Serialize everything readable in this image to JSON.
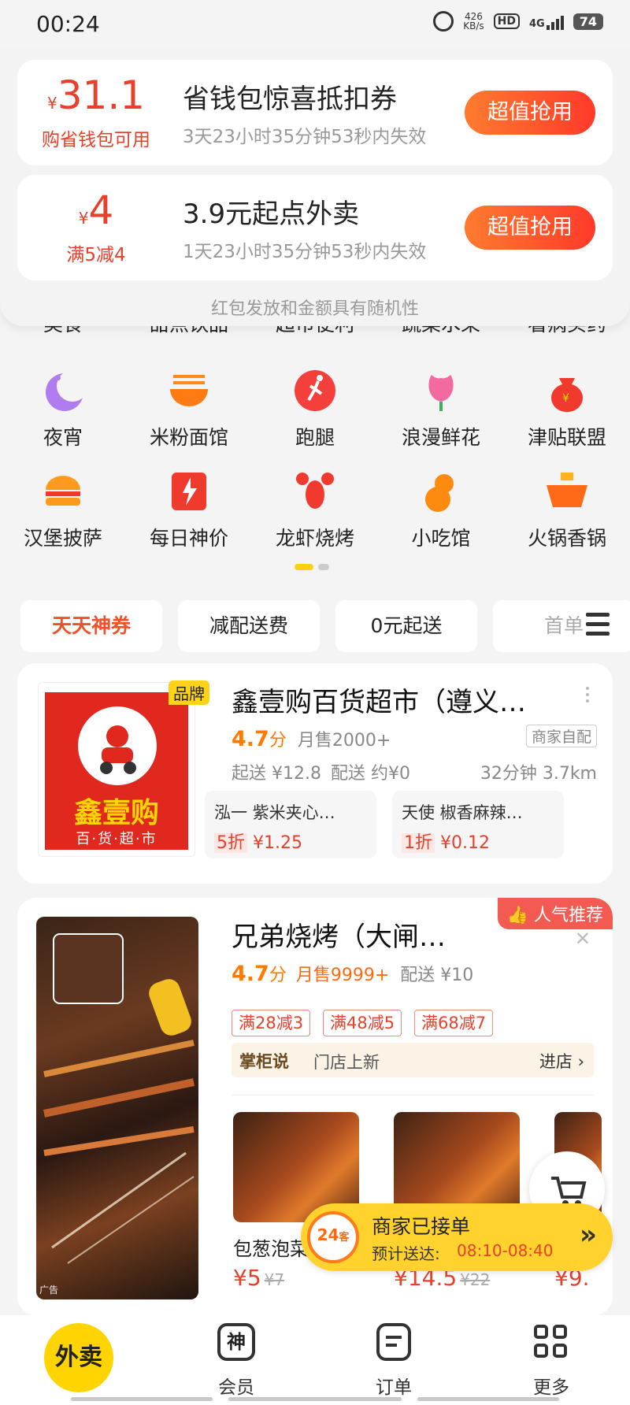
{
  "status_bar": {
    "time": "00:24",
    "speed_value": "426",
    "speed_unit": "KB/s",
    "hd": "HD",
    "network": "4G",
    "battery": "74"
  },
  "coupons": [
    {
      "symbol": "¥",
      "amount": "31.1",
      "condition": "购省钱包可用",
      "title": "省钱包惊喜抵扣券",
      "subtitle": "3天23小时35分钟53秒内失效",
      "button": "超值抢用"
    },
    {
      "symbol": "¥",
      "amount": "4",
      "condition": "满5减4",
      "title": "3.9元起点外卖",
      "subtitle": "1天23小时35分钟53秒内失效",
      "button": "超值抢用"
    }
  ],
  "disclaimer": "红包发放和金额具有随机性",
  "categories": {
    "row0": [
      "美食",
      "甜点饮品",
      "超市便利",
      "蔬菜水果",
      "看病买药"
    ],
    "row1": [
      {
        "label": "夜宵",
        "icon": "moon-icon"
      },
      {
        "label": "米粉面馆",
        "icon": "noodle-bowl-icon"
      },
      {
        "label": "跑腿",
        "icon": "runner-icon"
      },
      {
        "label": "浪漫鲜花",
        "icon": "flower-icon"
      },
      {
        "label": "津贴联盟",
        "icon": "money-bag-icon"
      }
    ],
    "row2": [
      {
        "label": "汉堡披萨",
        "icon": "burger-icon"
      },
      {
        "label": "每日神价",
        "icon": "lightning-icon"
      },
      {
        "label": "龙虾烧烤",
        "icon": "lobster-icon"
      },
      {
        "label": "小吃馆",
        "icon": "gourd-icon"
      },
      {
        "label": "火锅香锅",
        "icon": "hotpot-icon"
      }
    ]
  },
  "filters": [
    "天天神券",
    "减配送费",
    "0元起送",
    "首单"
  ],
  "store1": {
    "brand_tag": "品牌",
    "logo_text": "鑫壹购",
    "logo_sub": "百·货·超·市",
    "name": "鑫壹购百货超市（遵义…",
    "rating": "4.7",
    "rating_unit": "分",
    "monthly": "月售2000+",
    "delivery_tag": "商家自配",
    "min_order": "起送 ¥12.8",
    "delivery_fee": "配送 约¥0",
    "time_dist": "32分钟 3.7km",
    "deals": [
      {
        "name": "泓一 紫米夹心…",
        "discount": "5折",
        "price": "¥1.25"
      },
      {
        "name": "天使 椒香麻辣…",
        "discount": "1折",
        "price": "¥0.12"
      }
    ]
  },
  "store2": {
    "pop_tag": "人气推荐",
    "name": "兄弟烧烤（大闸…",
    "rating": "4.7",
    "rating_unit": "分",
    "monthly": "月售9999+",
    "delivery_fee": "配送 ¥10",
    "promos": [
      "满28减3",
      "满48减5",
      "满68减7"
    ],
    "say_label": "掌柜说",
    "say_text": "门店上新",
    "enter": "进店 ›",
    "ad_tag": "广告",
    "dishes": [
      {
        "name": "包葱泡菜",
        "price": "¥5",
        "orig": "¥7"
      },
      {
        "name": "",
        "price": "¥14.5",
        "orig": "¥22"
      },
      {
        "name": "",
        "price": "¥9.",
        "orig": ""
      }
    ]
  },
  "order_banner": {
    "badge": "24",
    "badge_sub": "客",
    "title": "商家已接单",
    "eta_label": "预计送达:",
    "eta_time": "08:10-08:40",
    "arrow": "»"
  },
  "tabbar": {
    "takeout": "外卖",
    "member_icon": "神",
    "member": "会员",
    "orders": "订单",
    "more": "更多"
  }
}
